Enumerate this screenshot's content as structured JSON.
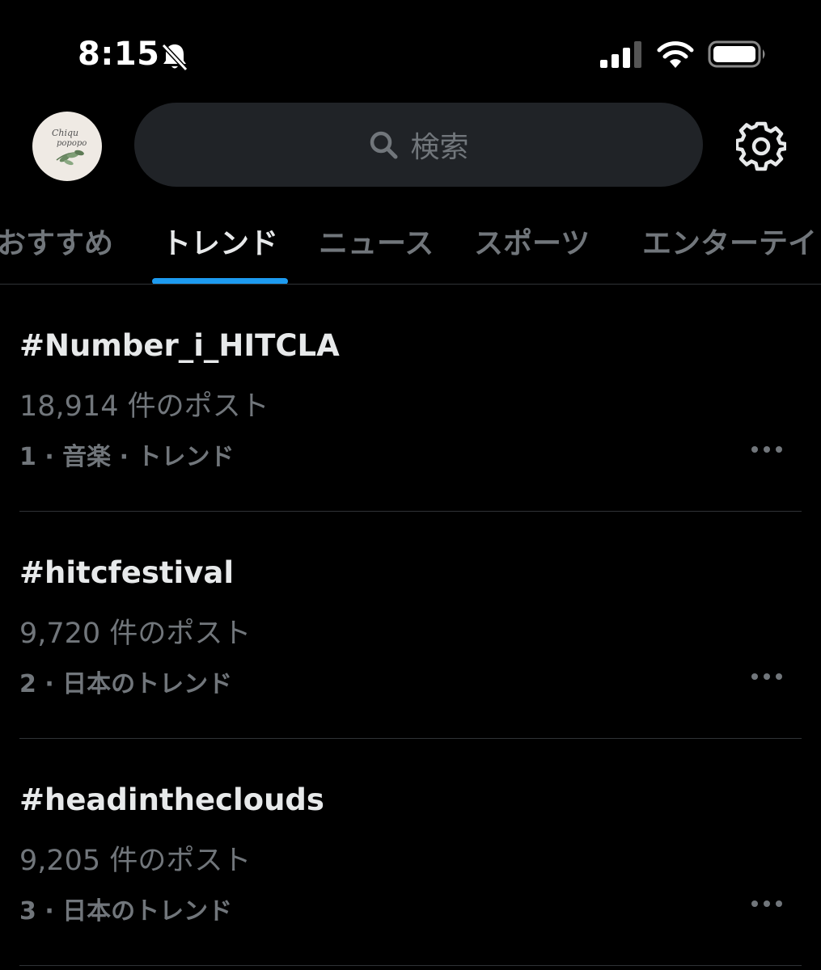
{
  "status_bar": {
    "time": "8:15",
    "icons": [
      "bell-slash-icon",
      "cellular-signal-icon",
      "wifi-icon",
      "battery-icon"
    ]
  },
  "header": {
    "avatar_text": [
      "Chiqu",
      "popopo"
    ],
    "search_placeholder": "検索",
    "search_icon": "search-icon",
    "settings_icon": "gear-icon"
  },
  "tabs": [
    {
      "label": "おすすめ",
      "active": false
    },
    {
      "label": "トレンド",
      "active": true
    },
    {
      "label": "ニュース",
      "active": false
    },
    {
      "label": "スポーツ",
      "active": false
    },
    {
      "label": "エンターテイ",
      "active": false
    }
  ],
  "trends": [
    {
      "title": "#Number_i_HITCLA",
      "posts": "18,914 件のポスト",
      "meta": "1 · 音楽 · トレンド"
    },
    {
      "title": "#hitcfestival",
      "posts": "9,720 件のポスト",
      "meta": "2 · 日本のトレンド"
    },
    {
      "title": "#headintheclouds",
      "posts": "9,205 件のポスト",
      "meta": "3 · 日本のトレンド"
    }
  ],
  "colors": {
    "background": "#000000",
    "accent": "#1d9bf0",
    "text_primary": "#e7e9ea",
    "text_secondary": "#71767b",
    "search_bg": "#202327",
    "divider": "#2f3336"
  }
}
